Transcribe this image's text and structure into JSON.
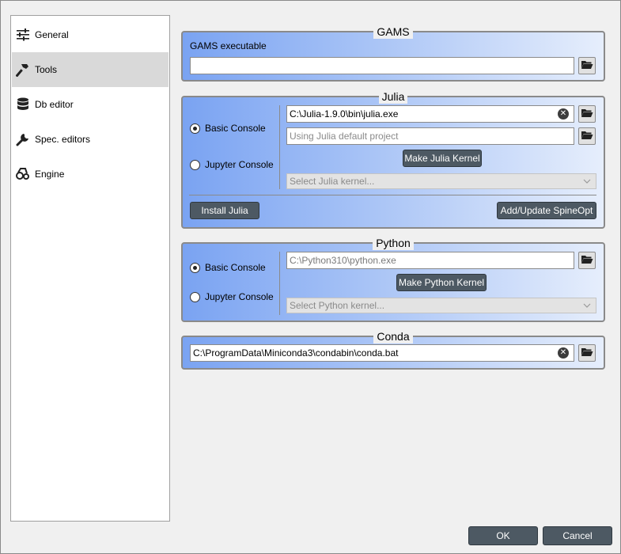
{
  "sidebar": {
    "items": [
      {
        "label": "General",
        "icon": "sliders-icon"
      },
      {
        "label": "Tools",
        "icon": "hammer-icon",
        "selected": true
      },
      {
        "label": "Db editor",
        "icon": "database-icon"
      },
      {
        "label": "Spec. editors",
        "icon": "wrench-icon"
      },
      {
        "label": "Engine",
        "icon": "engine-icon"
      }
    ]
  },
  "gams": {
    "title": "GAMS",
    "executable_label": "GAMS executable",
    "executable_value": ""
  },
  "julia": {
    "title": "Julia",
    "basic_console_label": "Basic Console",
    "jupyter_console_label": "Jupyter Console",
    "selected_console": "basic",
    "executable_value": "C:\\Julia-1.9.0\\bin\\julia.exe",
    "project_placeholder": "Using Julia default project",
    "make_kernel_label": "Make Julia Kernel",
    "kernel_placeholder": "Select Julia kernel...",
    "install_label": "Install Julia",
    "update_spineopt_label": "Add/Update SpineOpt"
  },
  "python": {
    "title": "Python",
    "basic_console_label": "Basic Console",
    "jupyter_console_label": "Jupyter Console",
    "selected_console": "basic",
    "executable_placeholder": "C:\\Python310\\python.exe",
    "make_kernel_label": "Make Python Kernel",
    "kernel_placeholder": "Select Python kernel..."
  },
  "conda": {
    "title": "Conda",
    "executable_value": "C:\\ProgramData\\Miniconda3\\condabin\\conda.bat"
  },
  "dialog": {
    "ok_label": "OK",
    "cancel_label": "Cancel"
  },
  "colors": {
    "group_gradient_start": "#7aa3f2",
    "group_gradient_end": "#e6eefc",
    "dark_button": "#4d5963",
    "selected_item": "#d9d9d9"
  }
}
